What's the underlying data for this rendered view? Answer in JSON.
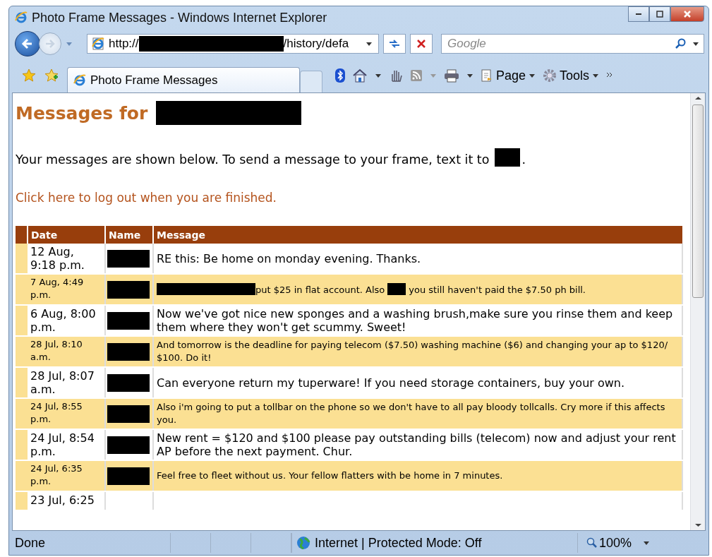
{
  "window": {
    "title": "Photo Frame Messages - Windows Internet Explorer"
  },
  "address_bar": {
    "parts": [
      {
        "kind": "text",
        "text": "http://"
      },
      {
        "kind": "redacted_long"
      },
      {
        "kind": "text",
        "text": "/history/defa"
      }
    ]
  },
  "search": {
    "placeholder": "Google"
  },
  "tabs": [
    {
      "label": "Photo Frame Messages",
      "selected": true
    }
  ],
  "command_bar": [
    {
      "kind": "page",
      "label": "Page"
    },
    {
      "kind": "tools",
      "label": "Tools"
    }
  ],
  "page": {
    "heading": [
      {
        "kind": "text",
        "text": "Messages for"
      },
      {
        "kind": "redacted_long"
      }
    ],
    "intro": [
      {
        "kind": "text",
        "text": "Your messages are shown below. To send a message to your frame, text it to"
      },
      {
        "kind": "redacted_short"
      },
      {
        "kind": "text",
        "text": "."
      }
    ],
    "logout_link": "Click here to log out when you are finished.",
    "table": {
      "columns": [
        "Date",
        "Name",
        "Message"
      ],
      "rows": [
        {
          "date": "12 Aug, 9:18 p.m.",
          "name_hidden": true,
          "shaded": false,
          "message": [
            {
              "kind": "text",
              "text": "RE this: Be home on monday evening. Thanks."
            }
          ]
        },
        {
          "date": "7 Aug, 4:49 p.m.",
          "name_hidden": true,
          "shaded": true,
          "message": [
            {
              "kind": "redacted_long"
            },
            {
              "kind": "text",
              "text": "put $25 in flat account. Also"
            },
            {
              "kind": "redacted_short"
            },
            {
              "kind": "text",
              "text": "you still haven't paid the $7.50 ph bill."
            }
          ]
        },
        {
          "date": "6 Aug, 8:00 p.m.",
          "name_hidden": true,
          "shaded": false,
          "message": [
            {
              "kind": "text",
              "text": "Now we've got nice new sponges and a washing brush,make sure you rinse them and keep them where they won't get scummy. Sweet!"
            }
          ]
        },
        {
          "date": "28 Jul, 8:10 a.m.",
          "name_hidden": true,
          "shaded": true,
          "message": [
            {
              "kind": "text",
              "text": "And tomorrow is the deadline for paying telecom ($7.50) washing machine ($6) and changing your ap to $120/ $100. Do it!"
            }
          ]
        },
        {
          "date": "28 Jul, 8:07 a.m.",
          "name_hidden": true,
          "shaded": false,
          "message": [
            {
              "kind": "text",
              "text": "Can everyone return my tuperware! If you need storage containers, buy your own."
            }
          ]
        },
        {
          "date": "24 Jul, 8:55 p.m.",
          "name_hidden": true,
          "shaded": true,
          "message": [
            {
              "kind": "text",
              "text": "Also i'm going to put a tollbar on the phone so we don't have to all pay bloody tollcalls. Cry more if this affects you."
            }
          ]
        },
        {
          "date": "24 Jul, 8:54 p.m.",
          "name_hidden": true,
          "shaded": false,
          "message": [
            {
              "kind": "text",
              "text": "New rent = $120 and $100 please pay outstanding bills (telecom) now and adjust your rent AP before the next payment. Chur."
            }
          ]
        },
        {
          "date": "24 Jul, 6:35 p.m.",
          "name_hidden": true,
          "shaded": true,
          "message": [
            {
              "kind": "text",
              "text": "Feel free to fleet without us. Your fellow flatters with be home in 7 minutes."
            }
          ]
        },
        {
          "date": "23 Jul, 6:25",
          "name_hidden": false,
          "shaded": false,
          "message": []
        }
      ]
    }
  },
  "status_bar": {
    "text": "Done",
    "zone": "Internet | Protected Mode: Off",
    "zoom": "100%"
  }
}
